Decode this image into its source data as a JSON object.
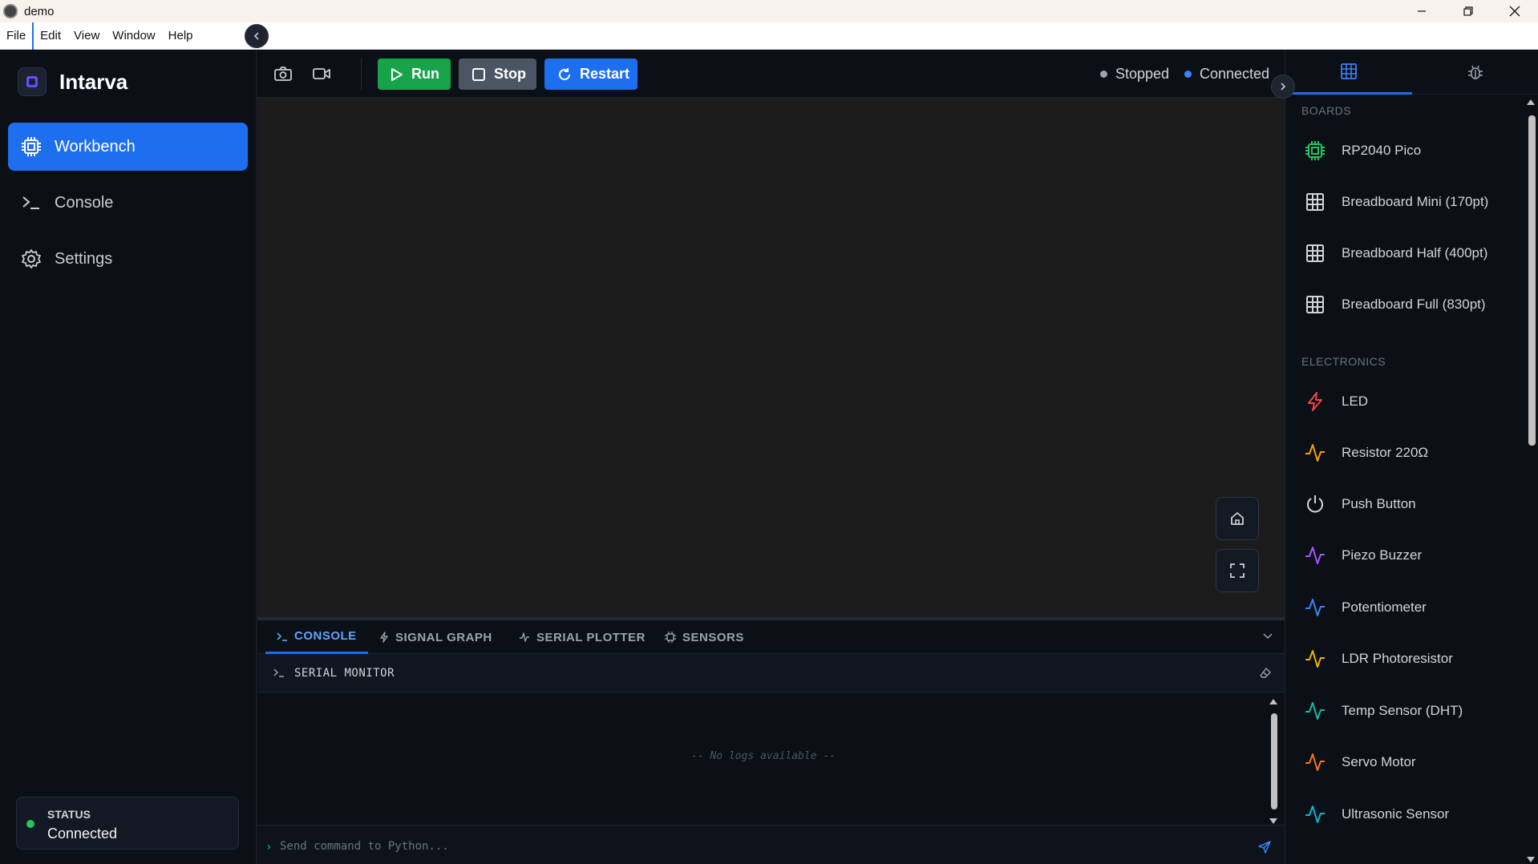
{
  "window": {
    "title": "demo"
  },
  "menu": [
    "File",
    "Edit",
    "View",
    "Window",
    "Help"
  ],
  "brand": {
    "name": "Intarva"
  },
  "nav": [
    {
      "label": "Workbench",
      "icon": "chip-icon",
      "active": true
    },
    {
      "label": "Console",
      "icon": "terminal-icon",
      "active": false
    },
    {
      "label": "Settings",
      "icon": "gear-icon",
      "active": false
    }
  ],
  "status": {
    "title": "STATUS",
    "value": "Connected",
    "color": "#22c55e"
  },
  "toolbar": {
    "run_label": "Run",
    "stop_label": "Stop",
    "restart_label": "Restart",
    "run_state": "Stopped",
    "connection": "Connected"
  },
  "bottom_panel": {
    "tabs": [
      {
        "label": "CONSOLE",
        "icon": "terminal-icon",
        "active": true
      },
      {
        "label": "SIGNAL GRAPH",
        "icon": "bolt-icon",
        "active": false
      },
      {
        "label": "SERIAL PLOTTER",
        "icon": "pulse-icon",
        "active": false
      },
      {
        "label": "SENSORS",
        "icon": "chip-icon",
        "active": false
      }
    ],
    "serial_monitor_title": "SERIAL MONITOR",
    "empty_text": "-- No logs available --",
    "command_placeholder": "Send command to Python..."
  },
  "library": {
    "boards_label": "BOARDS",
    "boards": [
      {
        "name": "RP2040 Pico",
        "icon": "chip-icon",
        "color": "#22c55e"
      },
      {
        "name": "Breadboard Mini (170pt)",
        "icon": "grid-icon",
        "color": "#d1d5db"
      },
      {
        "name": "Breadboard Half (400pt)",
        "icon": "grid-icon",
        "color": "#d1d5db"
      },
      {
        "name": "Breadboard Full (830pt)",
        "icon": "grid-icon",
        "color": "#d1d5db"
      }
    ],
    "electronics_label": "ELECTRONICS",
    "electronics": [
      {
        "name": "LED",
        "icon": "bolt-icon",
        "color": "#ef4444"
      },
      {
        "name": "Resistor 220Ω",
        "icon": "pulse-icon",
        "color": "#f59e0b"
      },
      {
        "name": "Push Button",
        "icon": "power-icon",
        "color": "#d1d5db"
      },
      {
        "name": "Piezo Buzzer",
        "icon": "pulse-icon",
        "color": "#a855f7"
      },
      {
        "name": "Potentiometer",
        "icon": "pulse-icon",
        "color": "#3b82f6"
      },
      {
        "name": "LDR Photoresistor",
        "icon": "pulse-icon",
        "color": "#eab308"
      },
      {
        "name": "Temp Sensor (DHT)",
        "icon": "pulse-icon",
        "color": "#14b8a6"
      },
      {
        "name": "Servo Motor",
        "icon": "pulse-icon",
        "color": "#f97316"
      },
      {
        "name": "Ultrasonic Sensor",
        "icon": "pulse-icon",
        "color": "#06b6d4"
      }
    ]
  }
}
